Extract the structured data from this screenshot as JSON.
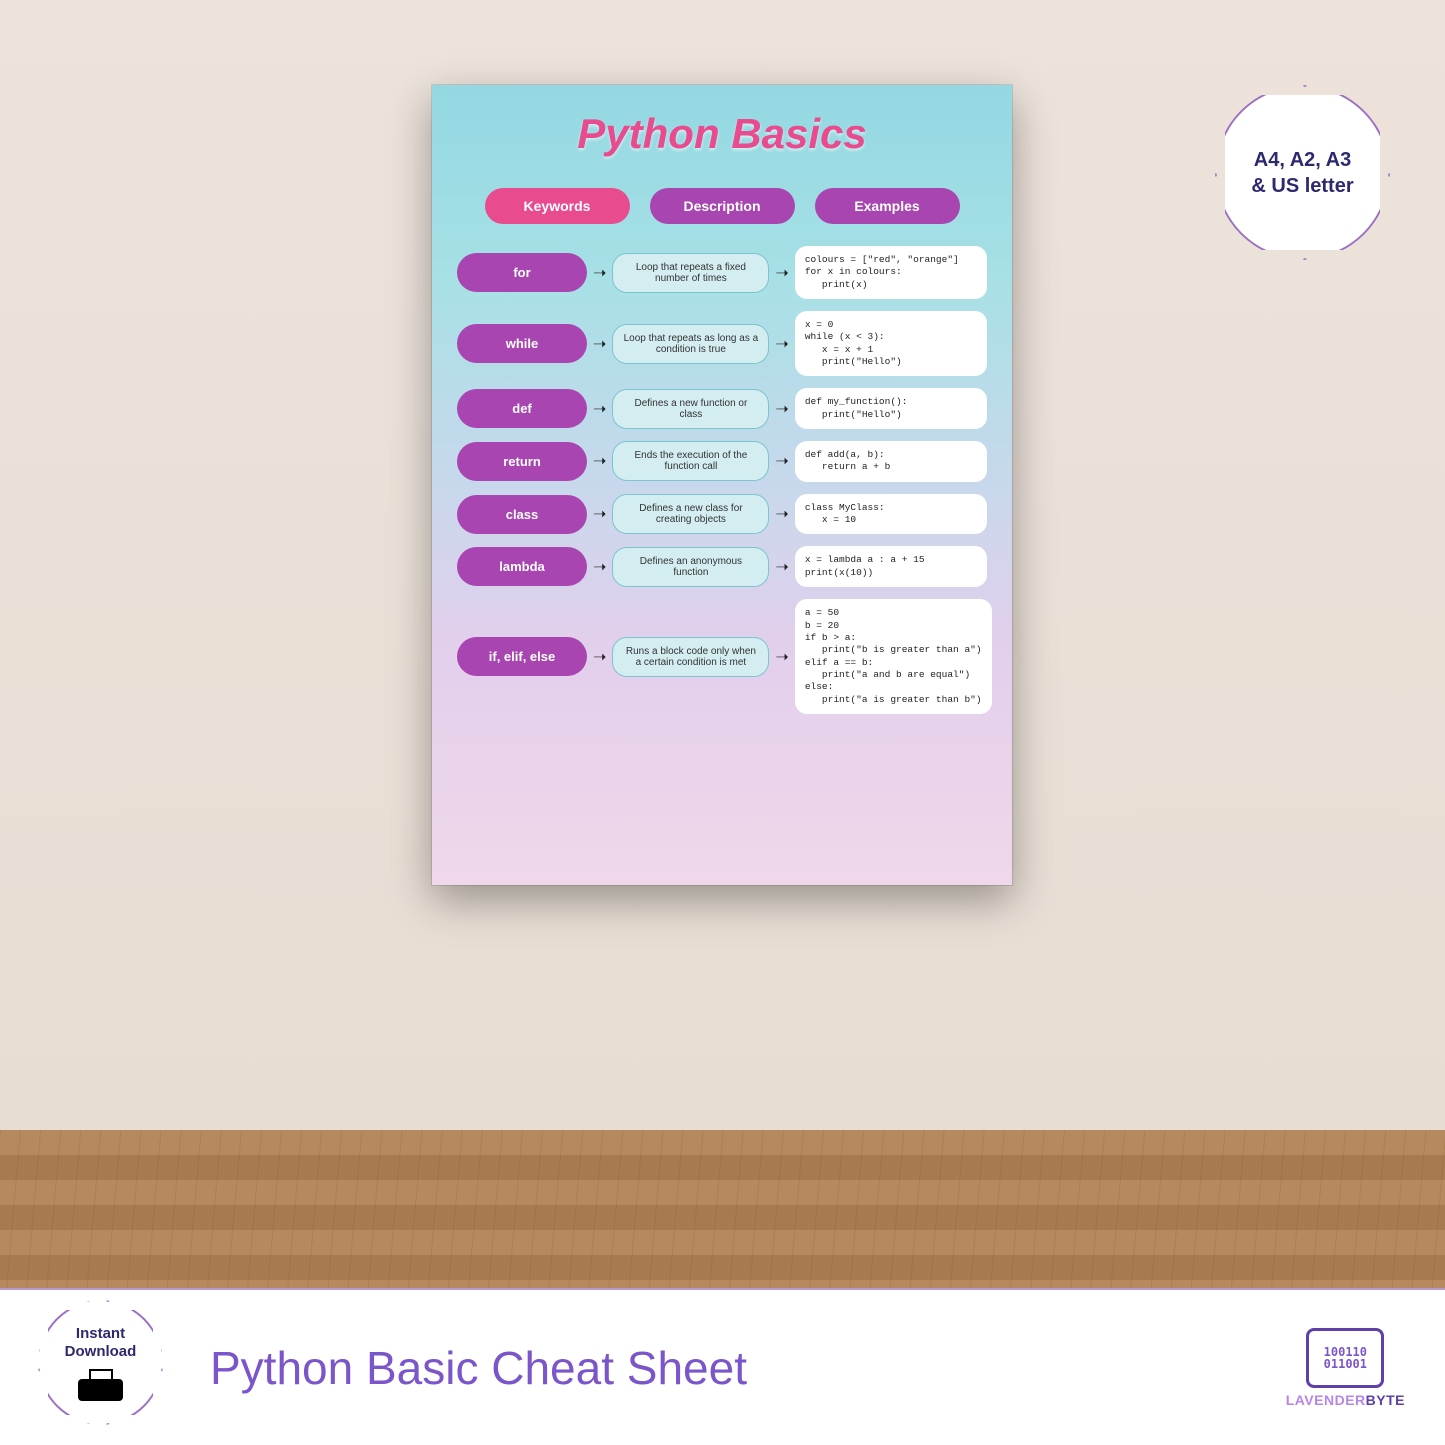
{
  "poster": {
    "title": "Python Basics",
    "headers": {
      "keywords": "Keywords",
      "description": "Description",
      "examples": "Examples"
    },
    "rows": [
      {
        "keyword": "for",
        "description": "Loop that repeats a fixed number of times",
        "example": "colours = [\"red\", \"orange\"]\nfor x in colours:\n   print(x)"
      },
      {
        "keyword": "while",
        "description": "Loop that repeats as long as a condition is true",
        "example": "x = 0\nwhile (x < 3):\n   x = x + 1\n   print(\"Hello\")"
      },
      {
        "keyword": "def",
        "description": "Defines a new function or class",
        "example": "def my_function():\n   print(\"Hello\")"
      },
      {
        "keyword": "return",
        "description": "Ends the execution of the function call",
        "example": "def add(a, b):\n   return a + b"
      },
      {
        "keyword": "class",
        "description": "Defines a new class for creating objects",
        "example": "class MyClass:\n   x = 10"
      },
      {
        "keyword": "lambda",
        "description": "Defines an anonymous function",
        "example": "x = lambda a : a + 15\nprint(x(10))"
      },
      {
        "keyword": "if, elif, else",
        "description": "Runs a block code only when a certain condition is met",
        "example": "a = 50\nb = 20\nif b > a:\n   print(\"b is greater than a\")\nelif a == b:\n   print(\"a and b are equal\")\nelse:\n   print(\"a is greater than b\")"
      }
    ]
  },
  "badges": {
    "sizes": "A4, A2, A3\n& US letter",
    "download": "Instant\nDownload"
  },
  "footer": {
    "product_title": "Python Basic Cheat Sheet",
    "logo_binary_top": "100110",
    "logo_binary_bottom": "011001",
    "logo_name_1": "LAVENDER",
    "logo_name_2": "BYTE"
  },
  "colors": {
    "pink": "#e94b8f",
    "purple": "#a845b0",
    "lavender": "#7b55ca",
    "teal_bg": "#d4edf0"
  }
}
